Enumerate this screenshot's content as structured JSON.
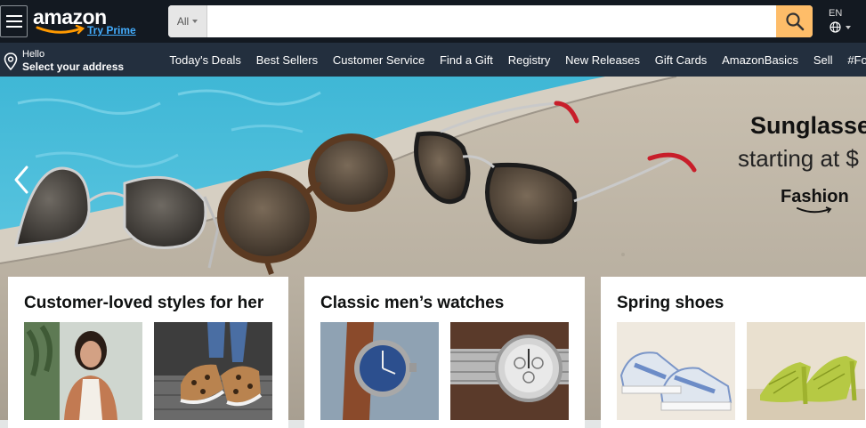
{
  "header": {
    "logo_text": "amazon",
    "try_prime": "Try Prime",
    "search": {
      "category": "All",
      "value": "",
      "placeholder": ""
    },
    "language": "EN"
  },
  "subnav": {
    "address_hello": "Hello",
    "address_main": "Select your address",
    "links": [
      "Today's Deals",
      "Best Sellers",
      "Customer Service",
      "Find a Gift",
      "Registry",
      "New Releases",
      "Gift Cards",
      "AmazonBasics",
      "Sell",
      "#FoundItOnAmazon"
    ]
  },
  "hero": {
    "title": "Sunglasses",
    "subtitle": "starting at $",
    "brand": "Fashion"
  },
  "cards": [
    {
      "title": "Customer-loved styles for her"
    },
    {
      "title": "Classic men’s watches"
    },
    {
      "title": "Spring shoes"
    }
  ],
  "colors": {
    "header_bg": "#131921",
    "subnav_bg": "#232f3e",
    "search_button": "#febd69",
    "prime_link": "#44aeff"
  }
}
